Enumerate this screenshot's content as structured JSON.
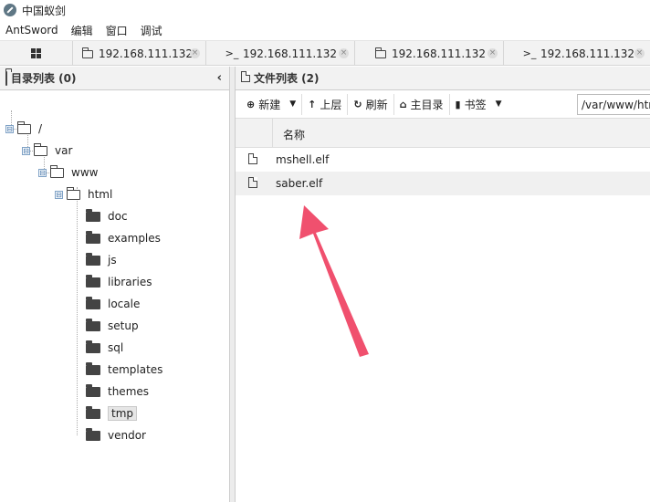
{
  "window": {
    "title": "中国蚁剑"
  },
  "menu": {
    "items": [
      "AntSword",
      "编辑",
      "窗口",
      "调试"
    ]
  },
  "tabs": [
    {
      "icon": "folder-icon",
      "label": "192.168.111.132"
    },
    {
      "icon": "terminal-icon",
      "label": "192.168.111.132",
      "icon_text": ">_"
    },
    {
      "icon": "folder-icon",
      "label": "192.168.111.132"
    },
    {
      "icon": "terminal-icon",
      "label": "192.168.111.132",
      "icon_text": ">_"
    }
  ],
  "left_panel": {
    "title": "目录列表 (0)",
    "tree": [
      {
        "label": "/",
        "level": 0,
        "type": "open"
      },
      {
        "label": "var",
        "level": 1,
        "type": "open"
      },
      {
        "label": "www",
        "level": 2,
        "type": "open"
      },
      {
        "label": "html",
        "level": 3,
        "type": "open"
      },
      {
        "label": "doc",
        "level": 4,
        "type": "closed"
      },
      {
        "label": "examples",
        "level": 4,
        "type": "closed"
      },
      {
        "label": "js",
        "level": 4,
        "type": "closed"
      },
      {
        "label": "libraries",
        "level": 4,
        "type": "closed"
      },
      {
        "label": "locale",
        "level": 4,
        "type": "closed"
      },
      {
        "label": "setup",
        "level": 4,
        "type": "closed"
      },
      {
        "label": "sql",
        "level": 4,
        "type": "closed"
      },
      {
        "label": "templates",
        "level": 4,
        "type": "closed"
      },
      {
        "label": "themes",
        "level": 4,
        "type": "closed"
      },
      {
        "label": "tmp",
        "level": 4,
        "type": "closed",
        "selected": true
      },
      {
        "label": "vendor",
        "level": 4,
        "type": "closed"
      }
    ]
  },
  "right_panel": {
    "title": "文件列表 (2)",
    "toolbar": {
      "new_label": "新建",
      "up_label": "上层",
      "refresh_label": "刷新",
      "home_label": "主目录",
      "bookmark_label": "书签",
      "path_value": "/var/www/html/tmp/"
    },
    "columns": {
      "name": "名称"
    },
    "files": [
      {
        "name": "mshell.elf"
      },
      {
        "name": "saber.elf"
      }
    ]
  },
  "colors": {
    "arrow": "#f0506e",
    "toggle_border": "#7fa2c6"
  },
  "toggle_glyph": "⊟",
  "collapse_glyph": "‹",
  "close_glyph": "×"
}
